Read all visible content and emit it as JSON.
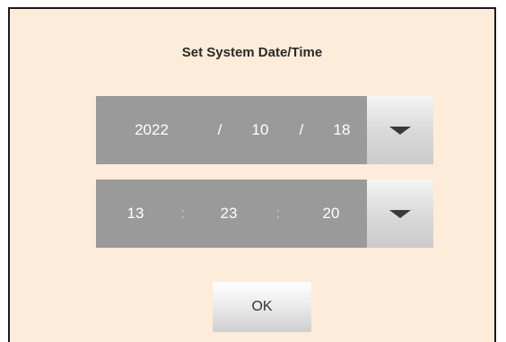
{
  "dialog": {
    "title": "Set System Date/Time"
  },
  "date_picker": {
    "year": "2022",
    "separator_1": "/",
    "month": "10",
    "separator_2": "/",
    "day": "18",
    "dropdown_icon": "triangle-down-icon"
  },
  "time_picker": {
    "hour": "13",
    "separator_1": ":",
    "minute": "23",
    "separator_2": ":",
    "second": "20",
    "dropdown_icon": "triangle-down-icon"
  },
  "buttons": {
    "ok_label": "OK"
  },
  "colors": {
    "dialog_background": "#fdecd9",
    "picker_background": "#9a9a9a",
    "picker_text": "#ffffff"
  }
}
